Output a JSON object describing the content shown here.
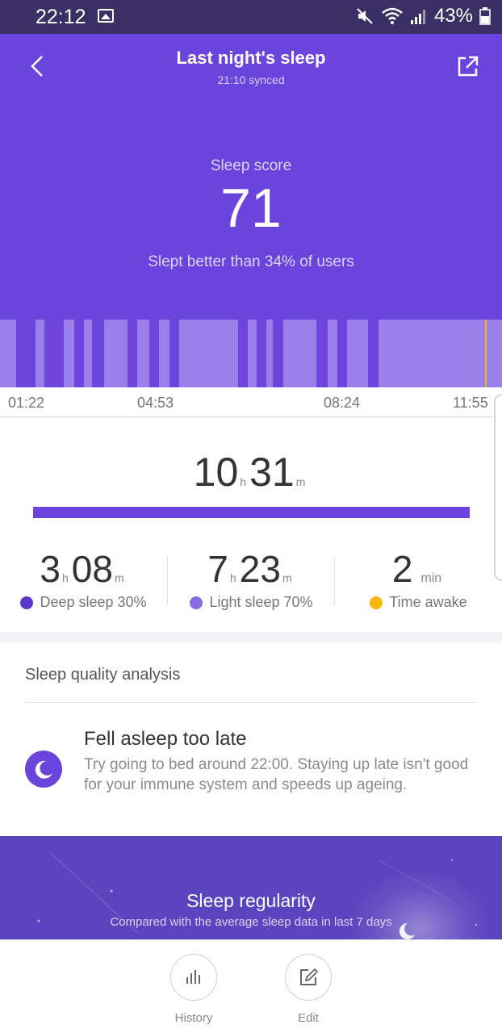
{
  "status_bar": {
    "time": "22:12",
    "battery": "43%"
  },
  "header": {
    "title": "Last night's sleep",
    "synced": "21:10 synced",
    "score_label": "Sleep score",
    "score": "71",
    "comparison": "Slept better than 34% of users"
  },
  "timeline": {
    "axis_labels": [
      "01:22",
      "04:53",
      "08:24",
      "11:55"
    ]
  },
  "summary": {
    "total_hours": "10",
    "total_minutes": "31",
    "hour_unit": "h",
    "minute_unit": "m",
    "deep": {
      "hours": "3",
      "minutes": "08",
      "label": "Deep sleep 30%",
      "color": "#5b37c9"
    },
    "light": {
      "hours": "7",
      "minutes": "23",
      "label": "Light sleep 70%",
      "color": "#8a6ae4"
    },
    "awake": {
      "value": "2",
      "unit": "min",
      "label": "Time awake",
      "color": "#f3b90e"
    }
  },
  "quality": {
    "heading": "Sleep quality analysis",
    "tip_title": "Fell asleep too late",
    "tip_body": "Try going to bed around 22:00. Staying up late isn't good for your immune system and speeds up ageing."
  },
  "regularity": {
    "title": "Sleep regularity",
    "subtitle": "Compared with the average sleep data in last 7 days"
  },
  "bottom_nav": {
    "history": "History",
    "edit": "Edit"
  },
  "colors": {
    "accent": "#6b43dd",
    "deep": "#6d44dc",
    "light": "#9a7ee9",
    "awake_marker": "#f0b21a"
  }
}
